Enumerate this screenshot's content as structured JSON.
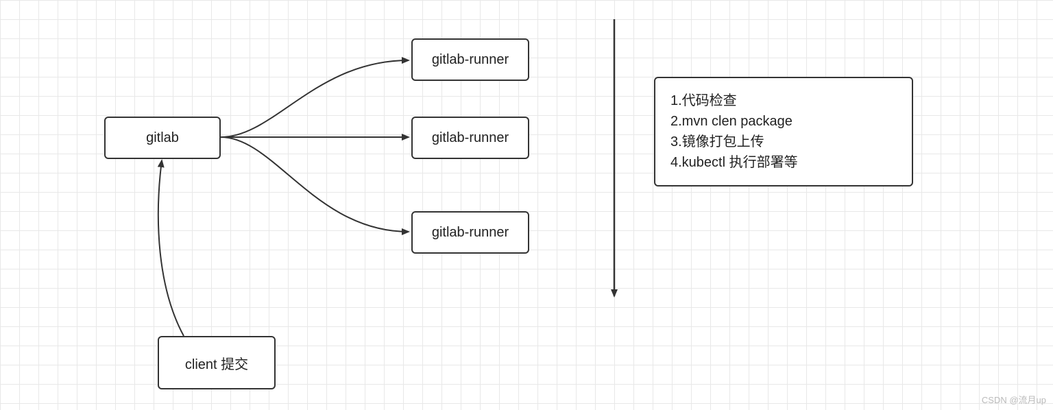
{
  "nodes": {
    "gitlab": "gitlab",
    "runner1": "gitlab-runner",
    "runner2": "gitlab-runner",
    "runner3": "gitlab-runner",
    "client": "client 提交"
  },
  "steps": {
    "line1": "1.代码检查",
    "line2": "2.mvn clen package",
    "line3": "3.镜像打包上传",
    "line4": "4.kubectl 执行部署等"
  },
  "watermark": "CSDN @流月up"
}
